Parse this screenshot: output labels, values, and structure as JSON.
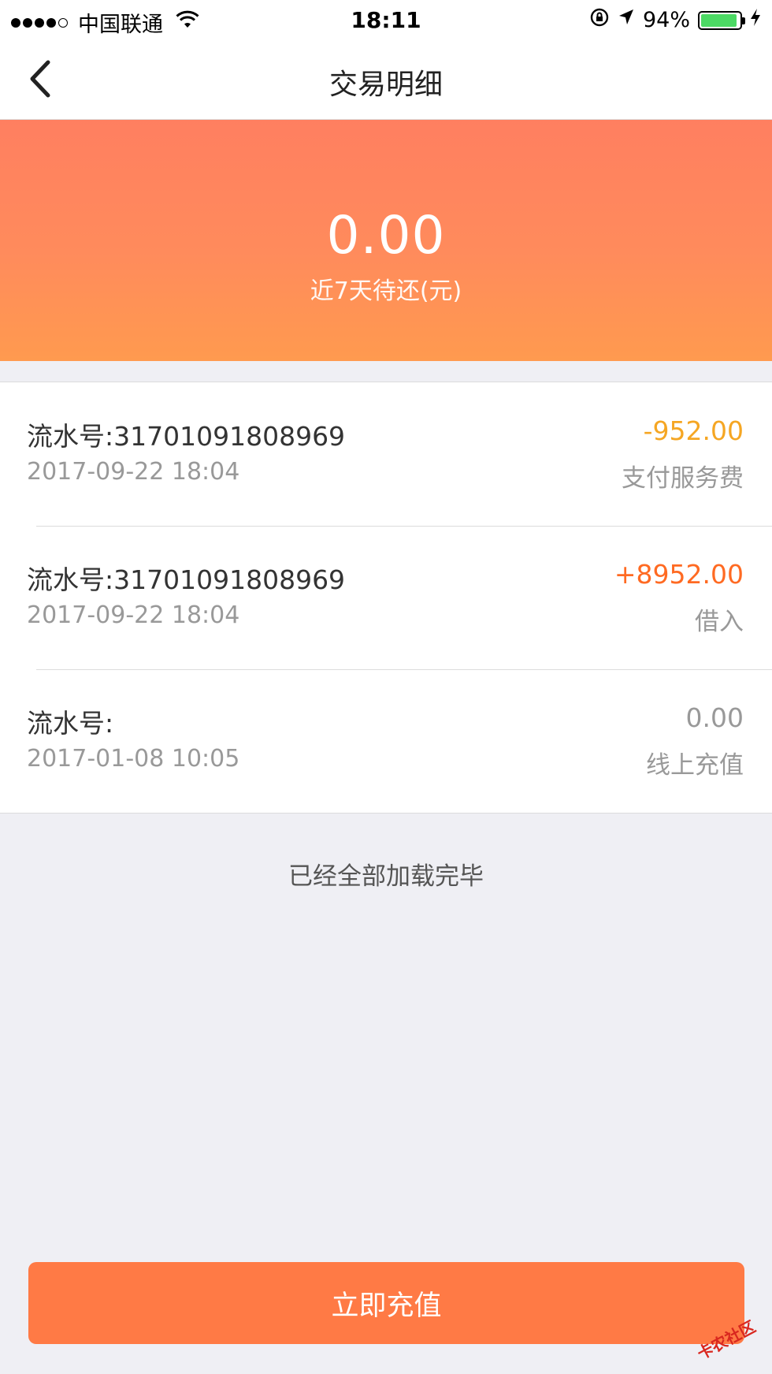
{
  "status_bar": {
    "carrier": "中国联通",
    "time": "18:11",
    "battery_percent": "94%",
    "battery_level": 0.94,
    "signal_bars_filled": 4,
    "signal_bars_total": 5
  },
  "nav": {
    "title": "交易明细"
  },
  "summary": {
    "amount": "0.00",
    "label": "近7天待还(元)"
  },
  "transactions": [
    {
      "serial": "流水号:31701091808969",
      "time": "2017-09-22 18:04",
      "amount": "-952.00",
      "type": "支付服务费",
      "amount_color": "#f5a623"
    },
    {
      "serial": "流水号:31701091808969",
      "time": "2017-09-22 18:04",
      "amount": "+8952.00",
      "type": "借入",
      "amount_color": "#ff6a22"
    },
    {
      "serial": "流水号:",
      "time": "2017-01-08 10:05",
      "amount": "0.00",
      "type": "线上充值",
      "amount_color": "#999999"
    }
  ],
  "footer_note": "已经全部加载完毕",
  "action": {
    "recharge_label": "立即充值"
  },
  "watermark": "卡农社区",
  "colors": {
    "accent": "#ff7a45",
    "hero_top": "#ff7f60",
    "hero_bottom": "#ff9a4f",
    "background": "#efeff4"
  }
}
